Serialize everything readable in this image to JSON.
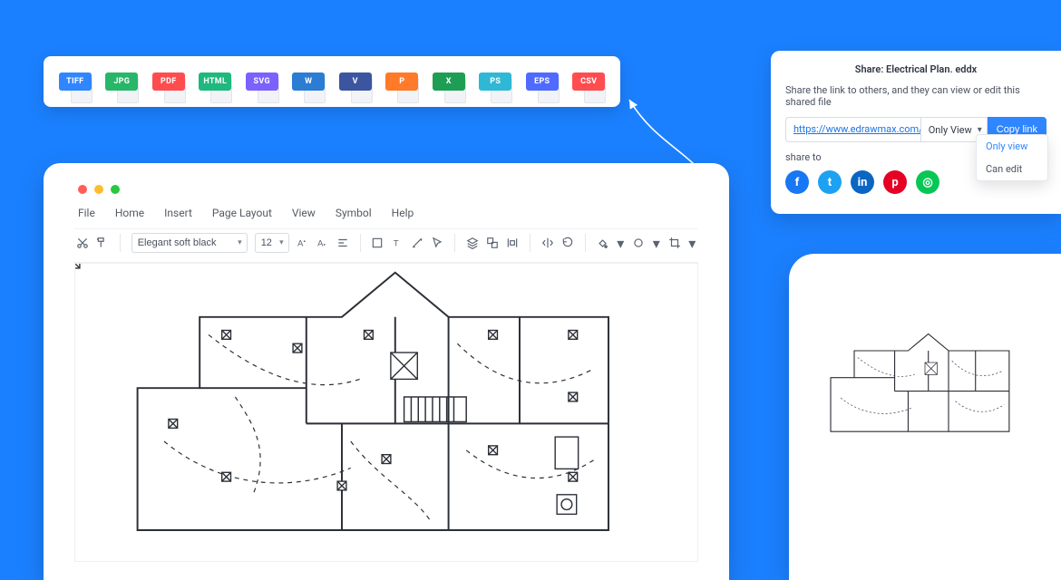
{
  "formats": [
    {
      "name": "TIFF",
      "color": "#2f86ff"
    },
    {
      "name": "JPG",
      "color": "#28b669"
    },
    {
      "name": "PDF",
      "color": "#ff4d4f"
    },
    {
      "name": "HTML",
      "color": "#1fb87f"
    },
    {
      "name": "SVG",
      "color": "#7b61ff"
    },
    {
      "name": "W",
      "color": "#2b7cd3"
    },
    {
      "name": "V",
      "color": "#3b55a0"
    },
    {
      "name": "P",
      "color": "#ff7a29"
    },
    {
      "name": "X",
      "color": "#1e9e55"
    },
    {
      "name": "PS",
      "color": "#2fb8d6"
    },
    {
      "name": "EPS",
      "color": "#4f6bff"
    },
    {
      "name": "CSV",
      "color": "#ff4d4f"
    }
  ],
  "editor": {
    "menu": [
      "File",
      "Home",
      "Insert",
      "Page Layout",
      "View",
      "Symbol",
      "Help"
    ],
    "font_name": "Elegant soft black",
    "font_size": "12"
  },
  "share": {
    "title": "Share: Electrical Plan. eddx",
    "subtitle": "Share the link to others, and they can view or edit this shared file",
    "url": "https://www.edrawmax.com/online/files",
    "permission_selected": "Only View",
    "permission_options": [
      "Only view",
      "Can edit"
    ],
    "copy_label": "Copy link",
    "share_to_label": "share to",
    "social": [
      {
        "name": "facebook",
        "glyph": "f",
        "color": "#1877f2"
      },
      {
        "name": "twitter",
        "glyph": "t",
        "color": "#1da1f2"
      },
      {
        "name": "linkedin",
        "glyph": "in",
        "color": "#0a66c2"
      },
      {
        "name": "pinterest",
        "glyph": "p",
        "color": "#e60023"
      },
      {
        "name": "line",
        "glyph": "◎",
        "color": "#06c755"
      }
    ]
  }
}
